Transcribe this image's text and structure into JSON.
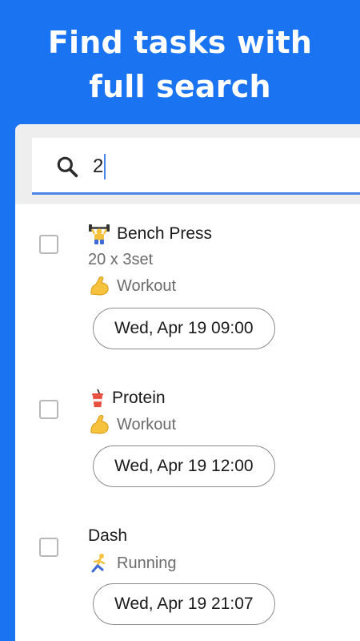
{
  "headline": {
    "line1": "Find tasks with",
    "line2": "full search"
  },
  "search": {
    "icon": "search-icon",
    "value": "2"
  },
  "tasks": [
    {
      "title": "Bench Press",
      "title_icon": "weightlifter-emoji",
      "note": "20 x 3set",
      "category": "Workout",
      "category_icon": "flexed-biceps-emoji",
      "date": "Wed, Apr 19 09:00",
      "checked": false
    },
    {
      "title": "Protein",
      "title_icon": "cup-with-straw-emoji",
      "note": "",
      "category": "Workout",
      "category_icon": "flexed-biceps-emoji",
      "date": "Wed, Apr 19 12:00",
      "checked": false
    },
    {
      "title": "Dash",
      "title_icon": "",
      "note": "",
      "category": "Running",
      "category_icon": "runner-emoji",
      "date": "Wed, Apr 19 21:07",
      "checked": false
    }
  ],
  "colors": {
    "background": "#1a73f0",
    "accent": "#4a86e8",
    "search_area": "#eeeeee"
  }
}
